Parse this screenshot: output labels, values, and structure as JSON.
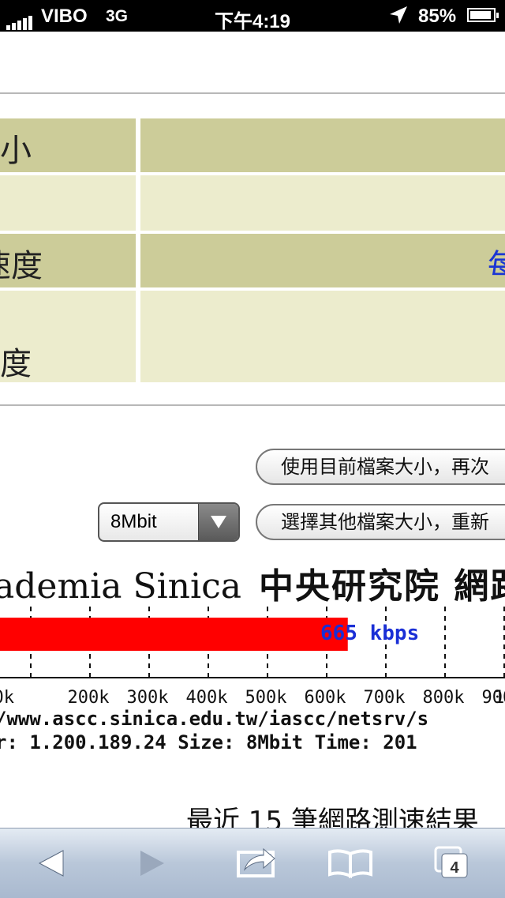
{
  "status_bar": {
    "carrier": "VIBO",
    "network": "3G",
    "time": "下午4:19",
    "battery_percent": "85%",
    "icons": [
      "signal-icon",
      "location-arrow-icon",
      "battery-charging-icon"
    ]
  },
  "table": {
    "rows": [
      {
        "label": "小",
        "value": ""
      },
      {
        "label": "",
        "value": ""
      },
      {
        "label": "速度",
        "value": "每"
      },
      {
        "label": "度",
        "value": ""
      }
    ]
  },
  "controls": {
    "rerun_button": "使用目前檔案大小，再次",
    "change_size_button": "選擇其他檔案大小，重新",
    "file_size_select": "8Mbit"
  },
  "banner": {
    "english": "ademia Sinica",
    "chinese": "中央研究院 網路"
  },
  "chart_data": {
    "type": "bar",
    "categories": [
      "speed"
    ],
    "values": [
      665
    ],
    "unit": "kbps",
    "readout": "665 kbps",
    "xlim": [
      0,
      1000
    ],
    "ticks": [
      "0k",
      "200k",
      "300k",
      "400k",
      "500k",
      "600k",
      "700k",
      "800k",
      "900k",
      "1"
    ],
    "bar_color": "#ff0000",
    "readout_color": "#1a2fd6"
  },
  "footer_text": {
    "url_line": "/www.ascc.sinica.edu.tw/iascc/netsrv/s",
    "info_line": "r: 1.200.189.24 Size: 8Mbit Time: 201"
  },
  "recent_results": "最近 15 筆網路測速結果",
  "toolbar": {
    "tabs_count": "4",
    "buttons": [
      "back-icon",
      "forward-icon",
      "share-icon",
      "bookmarks-icon",
      "tabs-icon"
    ]
  }
}
